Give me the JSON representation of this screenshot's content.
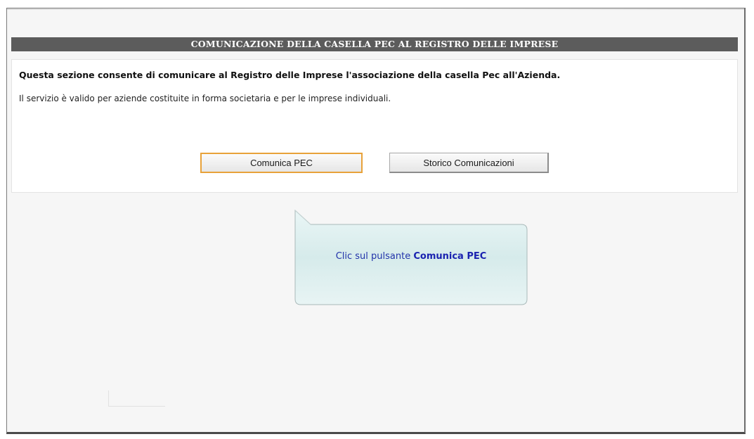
{
  "header": {
    "title": "COMUNICAZIONE DELLA CASELLA PEC AL REGISTRO DELLE IMPRESE"
  },
  "panel": {
    "intro_bold": "Questa sezione consente di comunicare al Registro delle Imprese l'associazione della casella Pec all'Azienda.",
    "intro_text": "Il servizio è valido per aziende costituite in forma societaria e per le imprese individuali."
  },
  "buttons": {
    "comunica_pec": "Comunica PEC",
    "storico": "Storico Comunicazioni"
  },
  "callout": {
    "prefix": "Clic sul pulsante ",
    "emphasis": "Comunica PEC"
  },
  "colors": {
    "header_bg": "#5c5c5c",
    "primary_border": "#e8a23a",
    "callout_text": "#2233aa",
    "callout_bg": "#d8ecec"
  }
}
